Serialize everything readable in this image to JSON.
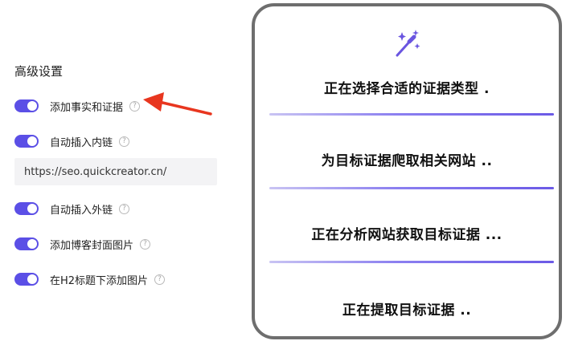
{
  "settings": {
    "title": "高级设置",
    "items": [
      {
        "label": "添加事实和证据",
        "enabled": true,
        "help": "?"
      },
      {
        "label": "自动插入内链",
        "enabled": true,
        "help": "?"
      },
      {
        "label": "自动插入外链",
        "enabled": true,
        "help": "?"
      },
      {
        "label": "添加博客封面图片",
        "enabled": true,
        "help": "?"
      },
      {
        "label": "在H2标题下添加图片",
        "enabled": true,
        "help": "?"
      }
    ],
    "internal_link_url": "https://seo.quickcreator.cn/"
  },
  "progress_panel": {
    "icon": "magic-wand-icon",
    "steps": [
      {
        "text": "正在选择合适的证据类型 ."
      },
      {
        "text": "为目标证据爬取相关网站 .."
      },
      {
        "text": "正在分析网站获取目标证据 ..."
      },
      {
        "text": "正在提取目标证据 .."
      }
    ]
  },
  "colors": {
    "toggle_on": "#5b4fe6",
    "arrow": "#e8361f",
    "accent_bar": "#6b5ae6",
    "card_border": "#6e6e6e"
  }
}
